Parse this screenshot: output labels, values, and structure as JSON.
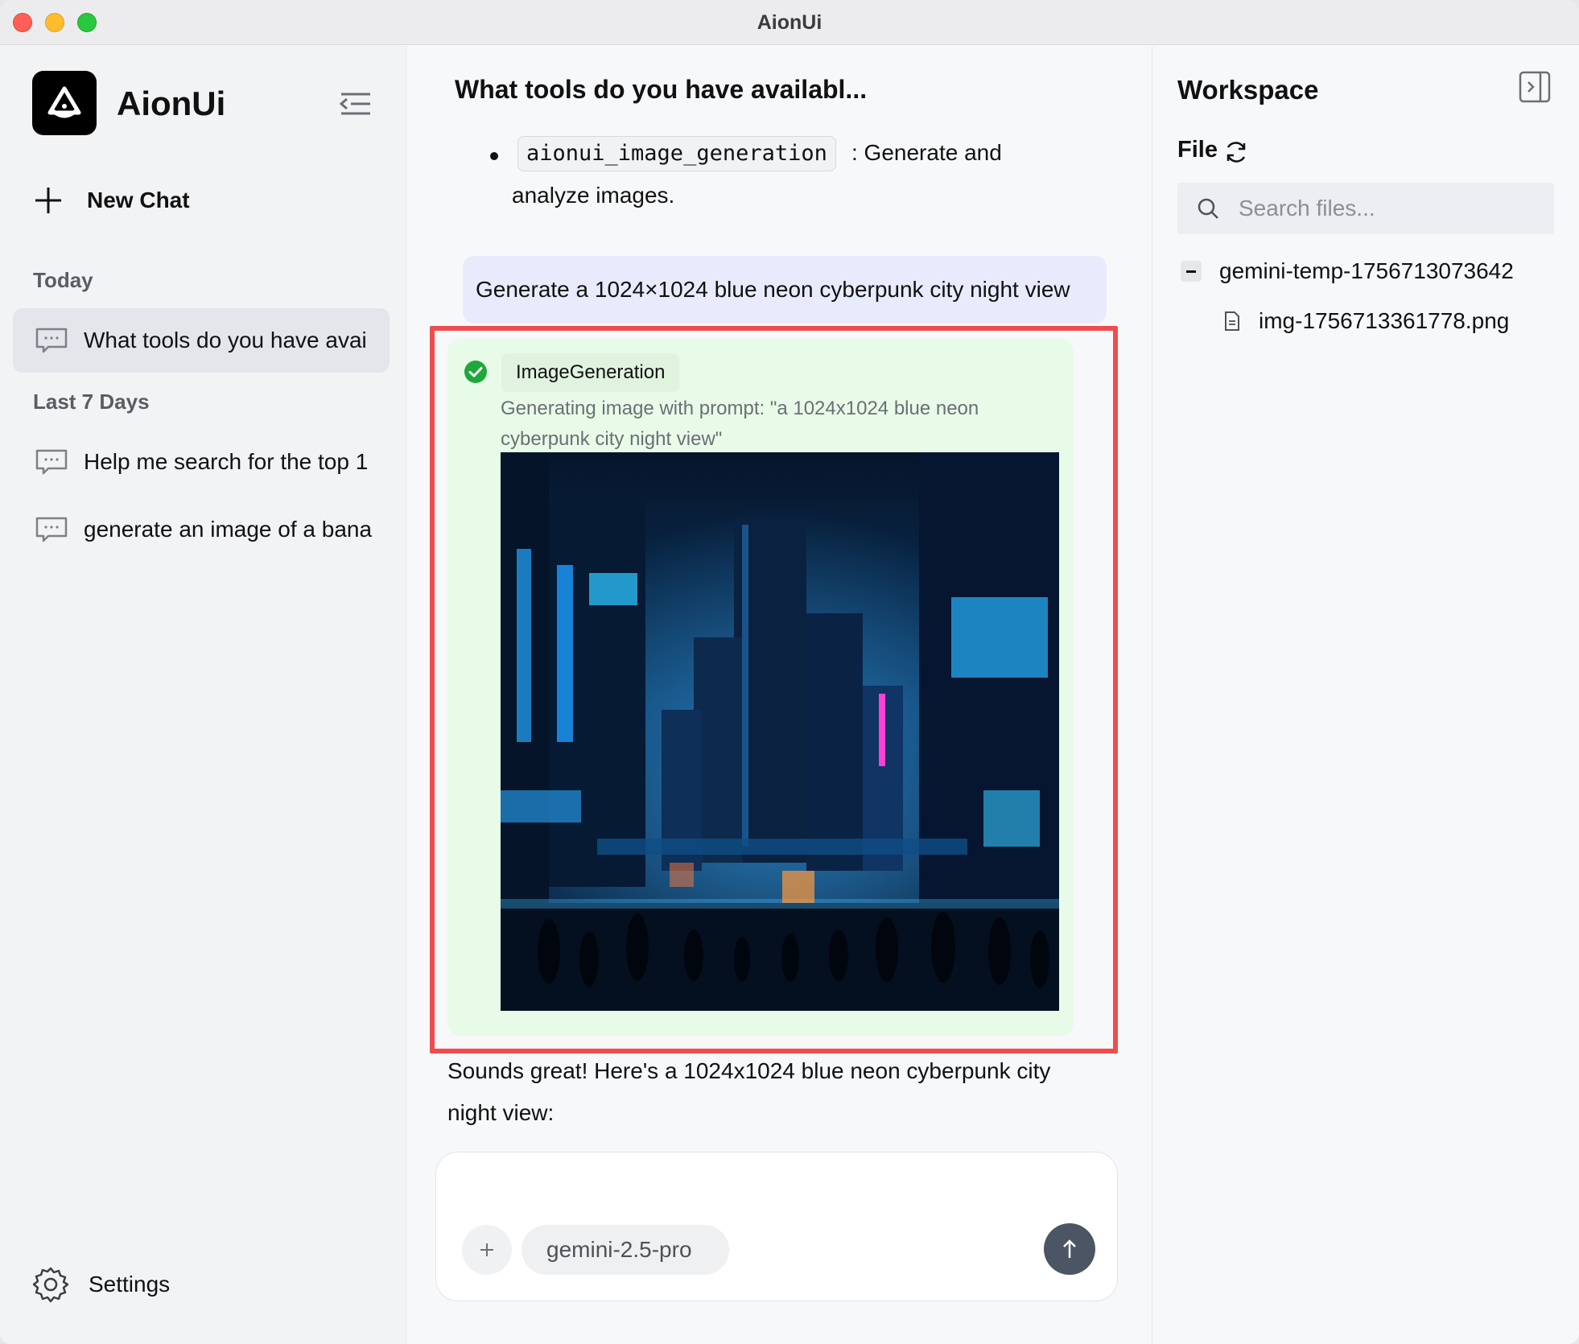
{
  "window": {
    "title": "AionUi"
  },
  "sidebar": {
    "app_name": "AionUi",
    "new_chat_label": "New Chat",
    "sections": [
      {
        "label": "Today",
        "items": [
          {
            "label": "What tools do you have avai",
            "active": true
          }
        ]
      },
      {
        "label": "Last 7 Days",
        "items": [
          {
            "label": "Help me search for the top 1",
            "active": false
          },
          {
            "label": "generate an image of a bana",
            "active": false
          }
        ]
      }
    ],
    "settings_label": "Settings"
  },
  "chat": {
    "title": "What tools do you have availabl...",
    "bullet": {
      "code": "aionui_image_generation",
      "text_after": ": Generate and",
      "text_cont": "analyze images."
    },
    "user_message": "Generate a 1024×1024 blue neon cyberpunk city night view",
    "tool_call": {
      "name": "ImageGeneration",
      "status": "success",
      "description": "Generating image with prompt: \"a 1024x1024 blue neon cyberpunk city night view\""
    },
    "assistant_reply": "Sounds great! Here's a 1024x1024 blue neon cyberpunk city night view:",
    "composer": {
      "model": "gemini-2.5-pro",
      "input_value": ""
    }
  },
  "workspace": {
    "title": "Workspace",
    "file_label": "File",
    "search_placeholder": "Search files...",
    "folder": "gemini-temp-1756713073642",
    "files": [
      "img-1756713361778.png"
    ]
  },
  "colors": {
    "highlight": "#ee4d4f",
    "tool_card_bg": "#e8fbe8",
    "user_bubble_bg": "#e8ebfb",
    "success": "#1ea83b",
    "send_button": "#4b5563"
  }
}
